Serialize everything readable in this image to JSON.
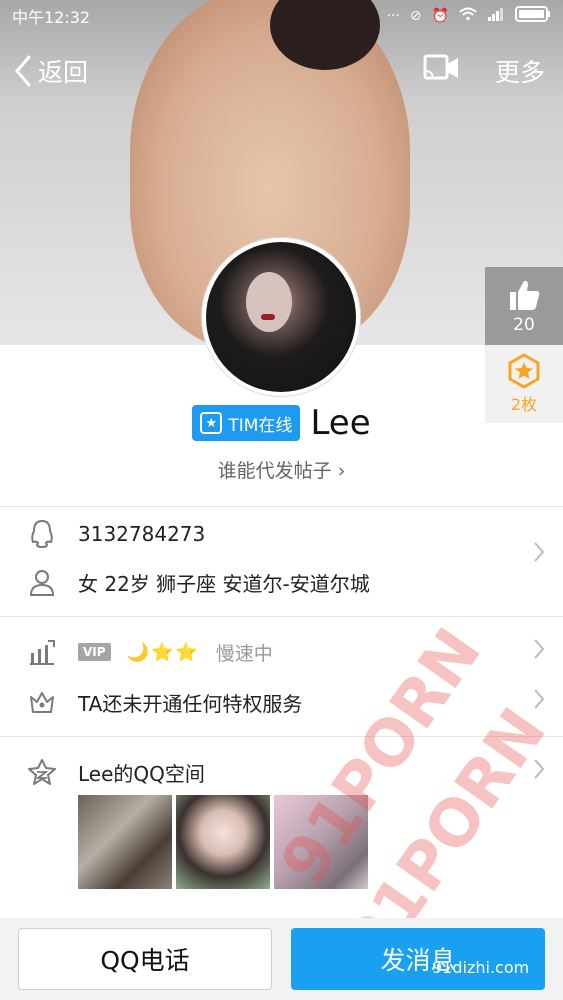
{
  "status_bar": {
    "time": "中午12:32",
    "icons": [
      "…",
      "⊘",
      "⏰",
      "wifi",
      "signal",
      "battery"
    ]
  },
  "nav": {
    "back_label": "返回",
    "more_label": "更多"
  },
  "profile": {
    "tim_label": "TIM在线",
    "name": "Lee",
    "signature": "谁能代发帖子 ›"
  },
  "side_panel": {
    "likes": "20",
    "medals": "2枚"
  },
  "info": {
    "qq_number": "3132784273",
    "personal": "女  22岁  狮子座  安道尔-安道尔城",
    "vip_tag": "VIP",
    "level_icons": "🌙⭐⭐",
    "speed": "慢速中",
    "privilege": "TA还未开通任何特权服务",
    "qzone": "Lee的QQ空间"
  },
  "buttons": {
    "call": "QQ电话",
    "message": "发消息"
  },
  "watermark": {
    "text": "91PORN",
    "site": "91dizhi.com"
  },
  "colors": {
    "accent": "#1aa0f0",
    "gold": "#f5a623"
  }
}
